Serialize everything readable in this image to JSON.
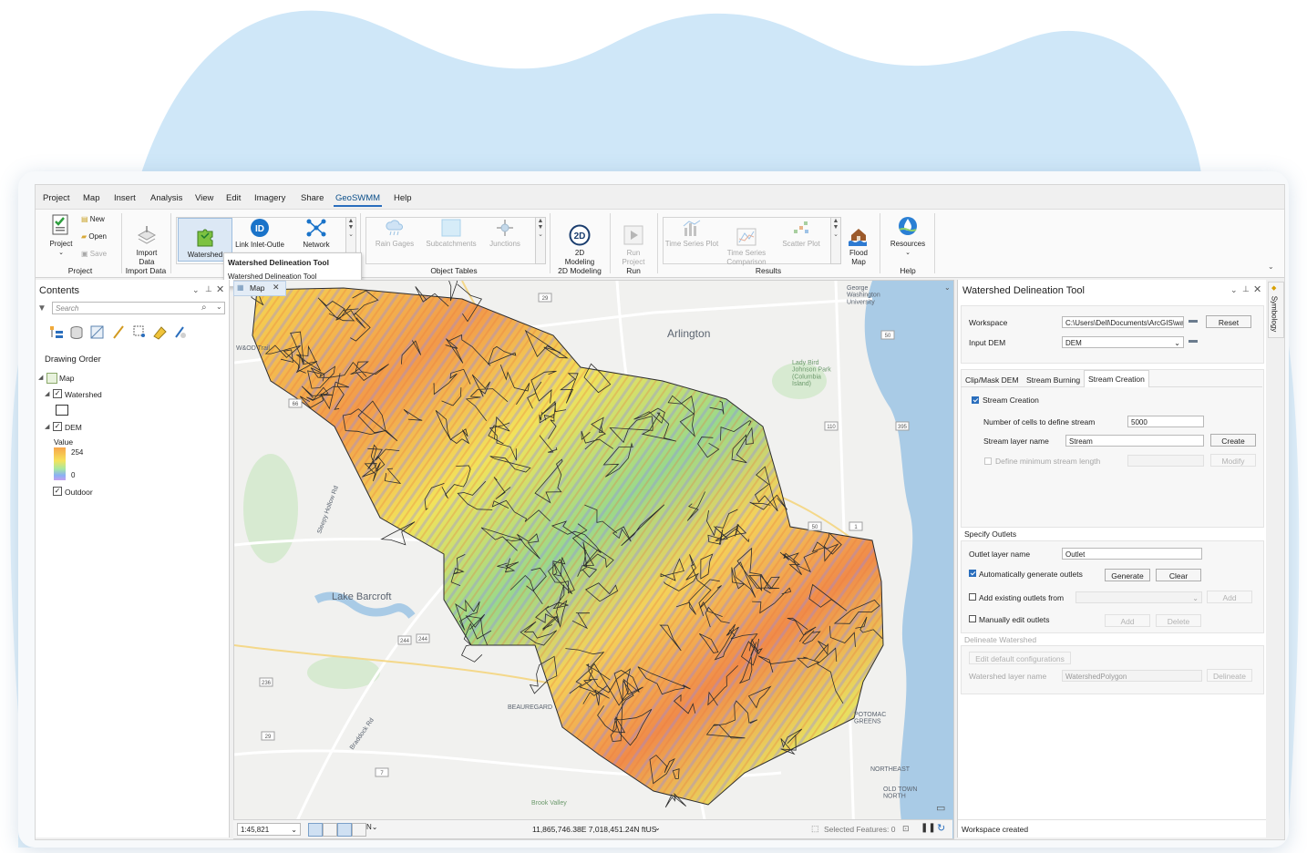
{
  "menu": {
    "items": [
      "Project",
      "Map",
      "Insert",
      "Analysis",
      "View",
      "Edit",
      "Imagery",
      "Share",
      "GeoSWMM",
      "Help"
    ],
    "active_index": 8
  },
  "ribbon": {
    "project_group": {
      "project_label": "Project",
      "new_label": "New",
      "open_label": "Open",
      "save_label": "Save",
      "group_label": "Project"
    },
    "import_group": {
      "import_label": "Import\nData",
      "group_label": "Import Data"
    },
    "tools": {
      "watershed_label": "Watershed\nDelineation To",
      "link_label": "Link Inlet-Outle",
      "network_label": "Network"
    },
    "object_tables": {
      "items": [
        "Rain Gages",
        "Subcatchments",
        "Junctions"
      ],
      "group_label": "Object Tables"
    },
    "modeling": {
      "label": "2D\nModeling",
      "icon_text": "2D",
      "group_label": "2D Modeling"
    },
    "run": {
      "label": "Run\nProject",
      "group_label": "Run"
    },
    "results": {
      "items": [
        "Time Series Plot",
        "Time Series\nComparison",
        "Scatter Plot"
      ],
      "flood_label": "Flood\nMap",
      "group_label": "Results"
    },
    "help": {
      "label": "Resources",
      "group_label": "Help"
    }
  },
  "tooltip": {
    "title": "Watershed Delineation Tool",
    "body": "Watershed Delineation Tool"
  },
  "contents": {
    "title": "Contents",
    "search_placeholder": "Search",
    "drawing_order": "Drawing Order",
    "map_label": "Map",
    "layers": [
      {
        "name": "Watershed",
        "checked": true
      },
      {
        "name": "DEM",
        "checked": true
      }
    ],
    "legend": {
      "title": "Value",
      "high": "254",
      "low": "0"
    },
    "basemap": {
      "name": "Outdoor",
      "checked": true
    }
  },
  "map": {
    "tab_label": "Map",
    "places": [
      {
        "text": "Arlington"
      },
      {
        "text": "Lake Barcroft"
      },
      {
        "text": "Lady Bird\nJohnson Park\n(Columbia\nIsland)"
      },
      {
        "text": "George\nWashington\nUniversity"
      },
      {
        "text": "Sleepy Hollow Rd"
      },
      {
        "text": "Braddock Rd"
      },
      {
        "text": "BEAUREGARD"
      },
      {
        "text": "NORTHEAST"
      },
      {
        "text": "OLD TOWN\nNORTH"
      },
      {
        "text": "Brook Valley"
      },
      {
        "text": "W&OD Trail"
      },
      {
        "text": "POTOMAC\nGREENS"
      }
    ],
    "shields": [
      "29",
      "50",
      "110",
      "395",
      "1",
      "244",
      "236",
      "29",
      "7",
      "66",
      "50",
      "244"
    ],
    "scale": "1:45,821",
    "coords": "11,865,746.38E 7,018,451.24N ftUS",
    "selected": "Selected Features: 0"
  },
  "tool": {
    "title": "Watershed Delineation Tool",
    "workspace_label": "Workspace",
    "workspace_value": "C:\\Users\\Dell\\Documents\\ArcGIS\\wa",
    "reset_label": "Reset",
    "dem_label": "Input DEM",
    "dem_value": "DEM",
    "tabs": [
      "Clip/Mask DEM",
      "Stream Burning",
      "Stream Creation"
    ],
    "active_tab": 2,
    "stream_creation_label": "Stream Creation",
    "cells_label": "Number of cells to define stream",
    "cells_value": "5000",
    "stream_layer_label": "Stream layer name",
    "stream_layer_value": "Stream",
    "create_label": "Create",
    "min_len_label": "Define minimum stream length",
    "modify_label": "Modify",
    "outlets_heading": "Specify Outlets",
    "outlet_layer_label": "Outlet layer name",
    "outlet_layer_value": "Outlet",
    "auto_label": "Automatically generate outlets",
    "generate_label": "Generate",
    "clear_label": "Clear",
    "existing_label": "Add existing outlets from",
    "add_label": "Add",
    "manual_label": "Manually edit outlets",
    "add2_label": "Add",
    "delete_label": "Delete",
    "delineate_heading": "Delineate Watershed",
    "edit_config_label": "Edit default configurations",
    "ws_layer_label": "Watershed layer name",
    "ws_layer_value": "WatershedPolygon",
    "delineate_label": "Delineate",
    "status": "Workspace created",
    "symbology_tab": "Symbology"
  },
  "colors": {
    "accent": "#2a6ebd",
    "blob": "#cfe7f8",
    "dem_high": "#f28a3c",
    "dem_mid": "#f5e65a",
    "dem_low": "#7b7cf0"
  }
}
